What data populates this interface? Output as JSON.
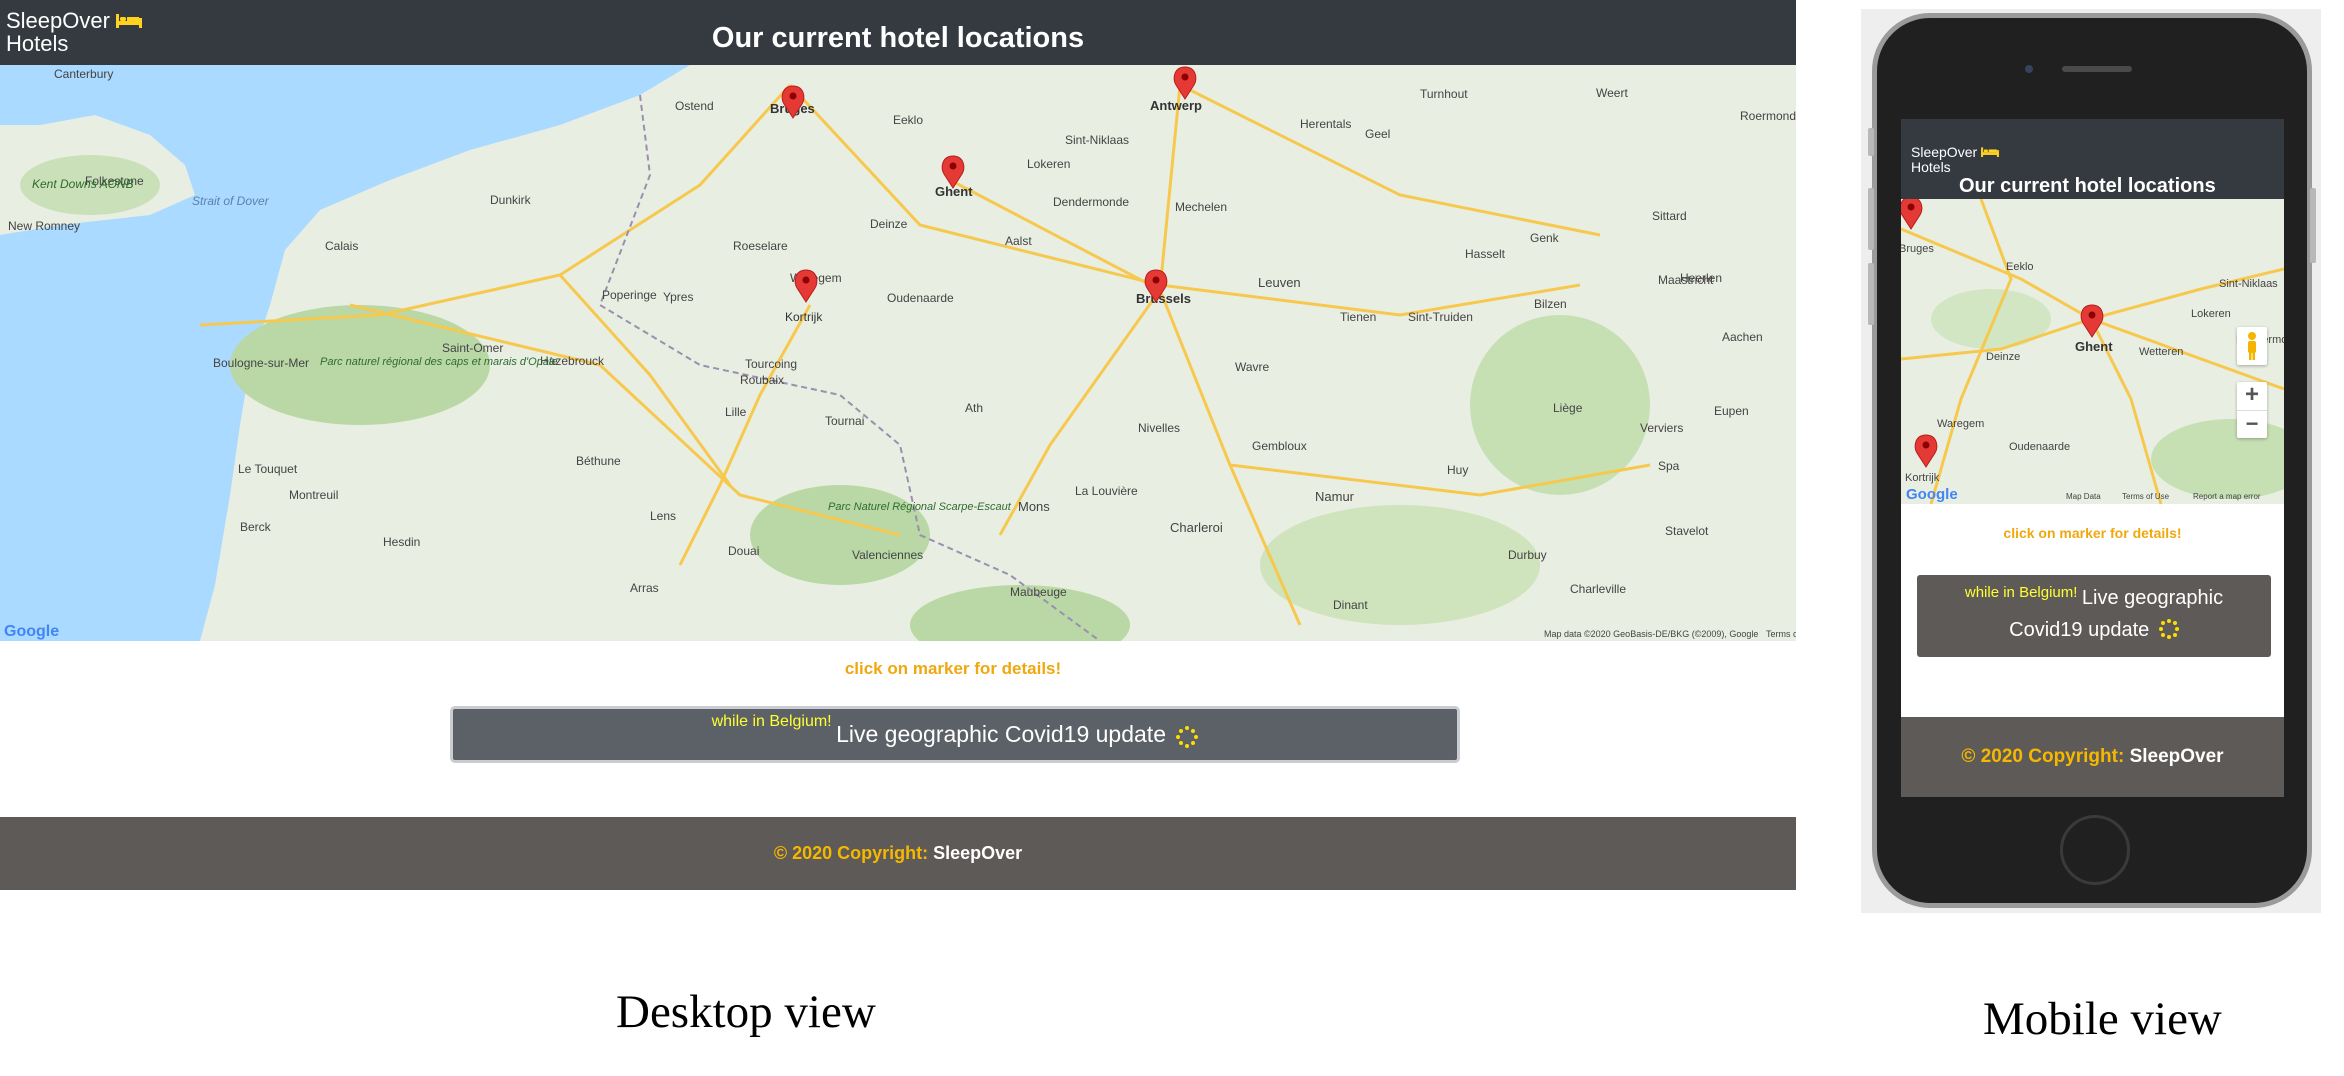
{
  "desktop": {
    "brand": {
      "line1": "SleepOver",
      "line2": "Hotels",
      "icon": "bed-icon"
    },
    "title": "Our current hotel locations",
    "map": {
      "cities": [
        "Bruges",
        "Antwerp",
        "Ghent",
        "Kortrijk",
        "Brussels",
        "Mechelen",
        "Lille",
        "Calais",
        "Dunkirk",
        "Roeselare",
        "Waregem",
        "Oudenaarde",
        "Tournai",
        "Mons",
        "Charleroi",
        "Namur",
        "Leuven",
        "Wavre",
        "Hasselt",
        "Liège",
        "Maastricht",
        "Genk",
        "Tienen",
        "Sint-Niklaas",
        "Dendermonde",
        "Aalst",
        "Ostend",
        "Folkestone",
        "Boulogne-sur-Mer",
        "Saint-Omer",
        "Arras",
        "Douai",
        "Lens",
        "Béthune",
        "Valenciennes",
        "La Louvière",
        "Aachen",
        "Heerlen",
        "Sittard",
        "Roermond",
        "Weert",
        "Geel",
        "Herentals",
        "Turnhout",
        "Eupen",
        "Verviers",
        "Spa",
        "Huy",
        "Gembloux",
        "Nivelles",
        "Ath",
        "Roubaix",
        "Tourcoing",
        "Hazebrouck",
        "Ypres",
        "Poperinge",
        "Le Touquet",
        "Berck",
        "Hesdin",
        "Montreuil",
        "Eeklo",
        "Deinze",
        "Lokeren",
        "Sint-Truiden",
        "Bilzen",
        "Kent Downs AONB",
        "New Romney",
        "Canterbury",
        "Strait of Dover",
        "Parc naturel régional des caps et marais d'Opale",
        "Parc Naturel Régional Scarpe-Escaut",
        "Maubeuge",
        "Charleville",
        "Dinant",
        "Durbuy",
        "Stavelot"
      ],
      "google": "Google",
      "attribution": "Map data ©2020 GeoBasis-DE/BKG (©2009), Google",
      "terms": "Terms of Use",
      "markers": [
        "Bruges",
        "Antwerp",
        "Ghent",
        "Kortrijk",
        "Brussels"
      ]
    },
    "click_text": "click on marker for details!",
    "covid": {
      "small": "while in Belgium!",
      "big": "Live geographic Covid19 update"
    },
    "footer": {
      "copy": "© 2020 Copyright:",
      "brand": "SleepOver"
    }
  },
  "mobile": {
    "brand": {
      "line1": "SleepOver",
      "line2": "Hotels",
      "icon": "bed-icon"
    },
    "title": "Our current hotel locations",
    "map": {
      "cities": [
        "Bruges",
        "Ghent",
        "Kortrijk",
        "Eeklo",
        "Sint-Niklaas",
        "Lokeren",
        "Dendermonde",
        "Wetteren",
        "Deinze",
        "Waregem",
        "Oudenaarde"
      ],
      "google": "Google",
      "map_data": "Map Data",
      "terms": "Terms of Use",
      "report": "Report a map error",
      "zoom_in": "+",
      "zoom_out": "−"
    },
    "click_text": "click on marker for details!",
    "covid": {
      "small": "while in Belgium!",
      "line1": "Live geographic",
      "line2": "Covid19 update"
    },
    "footer": {
      "copy": "© 2020 Copyright:",
      "brand": "SleepOver"
    }
  },
  "captions": {
    "desktop": "Desktop view",
    "mobile": "Mobile view"
  },
  "colors": {
    "header": "#343a40",
    "footer": "#5e5a57",
    "accent": "#f5b800",
    "marker": "#e53935",
    "water": "#aadaff"
  }
}
